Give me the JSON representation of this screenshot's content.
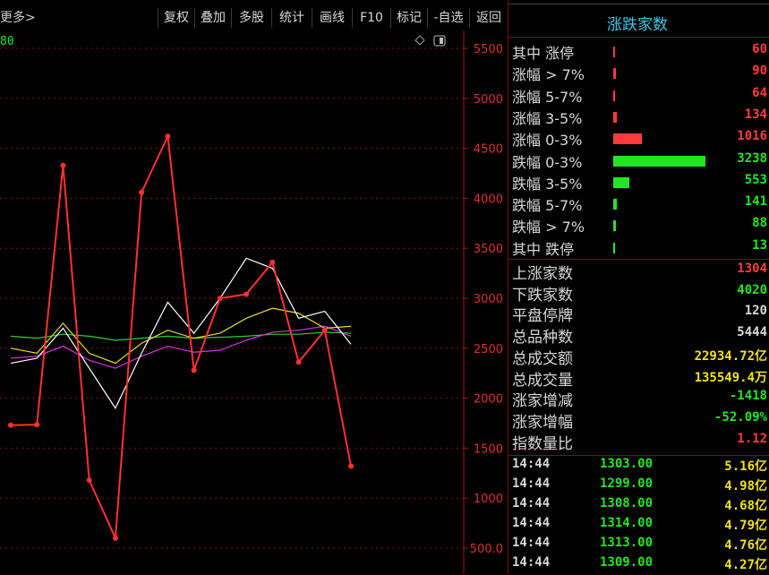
{
  "toolbar": {
    "more": "更多>",
    "buttons": [
      "复权",
      "叠加",
      "多股",
      "统计",
      "画线",
      "F10",
      "标记",
      "-自选",
      "返回"
    ]
  },
  "chart": {
    "corner_value": "80"
  },
  "chart_data": {
    "type": "line",
    "y_ticks": [
      "5500",
      "5000",
      "4500",
      "4000",
      "3500",
      "3000",
      "2500",
      "2000",
      "1500",
      "1000",
      "500.0"
    ],
    "ylim": [
      500,
      5500
    ],
    "grid": true,
    "series": [
      {
        "color": "#ff3030",
        "values": [
          1730,
          1735,
          4330,
          1180,
          600,
          4060,
          4620,
          2280,
          3000,
          3040,
          3360,
          2360,
          2680,
          1320
        ]
      },
      {
        "color": "#ffffff",
        "values": [
          2350,
          2400,
          2700,
          2300,
          1900,
          2450,
          2960,
          2650,
          3000,
          3400,
          3300,
          2800,
          2870,
          2540
        ]
      },
      {
        "color": "#e8e020",
        "values": [
          2500,
          2450,
          2750,
          2450,
          2350,
          2550,
          2680,
          2600,
          2650,
          2800,
          2900,
          2850,
          2700,
          2720
        ]
      },
      {
        "color": "#e030e0",
        "values": [
          2400,
          2420,
          2520,
          2380,
          2300,
          2420,
          2520,
          2460,
          2480,
          2580,
          2660,
          2680,
          2720,
          2620
        ]
      },
      {
        "color": "#30d030",
        "values": [
          2620,
          2600,
          2640,
          2620,
          2580,
          2600,
          2620,
          2600,
          2610,
          2620,
          2640,
          2640,
          2660,
          2650
        ]
      }
    ]
  },
  "panel": {
    "title": "涨跌家数",
    "dist": [
      {
        "label": "其中 涨停",
        "value": "60",
        "cls": "up",
        "bar": 0.02
      },
      {
        "label": "涨幅 > 7%",
        "value": "90",
        "cls": "up",
        "bar": 0.03
      },
      {
        "label": "涨幅 5-7%",
        "value": "64",
        "cls": "up",
        "bar": 0.02
      },
      {
        "label": "涨幅 3-5%",
        "value": "134",
        "cls": "up",
        "bar": 0.04
      },
      {
        "label": "涨幅 0-3%",
        "value": "1016",
        "cls": "up",
        "bar": 0.31
      },
      {
        "label": "跌幅 0-3%",
        "value": "3238",
        "cls": "dn",
        "bar": 1.0
      },
      {
        "label": "跌幅 3-5%",
        "value": "553",
        "cls": "dn",
        "bar": 0.17
      },
      {
        "label": "跌幅 5-7%",
        "value": "141",
        "cls": "dn",
        "bar": 0.04
      },
      {
        "label": "跌幅 > 7%",
        "value": "88",
        "cls": "dn",
        "bar": 0.03
      },
      {
        "label": "其中 跌停",
        "value": "13",
        "cls": "dn",
        "bar": 0.01
      }
    ],
    "stats": [
      {
        "label": "上涨家数",
        "value": "1304",
        "cls": "up"
      },
      {
        "label": "下跌家数",
        "value": "4020",
        "cls": "dn"
      },
      {
        "label": "平盘停牌",
        "value": "120",
        "cls": "wh"
      },
      {
        "label": "总品种数",
        "value": "5444",
        "cls": "wh"
      },
      {
        "label": "总成交额",
        "value": "22934.72亿",
        "cls": "yl"
      },
      {
        "label": "总成交量",
        "value": "135549.4万",
        "cls": "yl"
      },
      {
        "label": "涨家增减",
        "value": "-1418",
        "cls": "dn"
      },
      {
        "label": "涨家增幅",
        "value": "-52.09%",
        "cls": "dn"
      },
      {
        "label": "指数量比",
        "value": "1.12",
        "cls": "up"
      }
    ],
    "ticks": [
      {
        "time": "14:44",
        "price": "1303.00",
        "amount": "5.16亿"
      },
      {
        "time": "14:44",
        "price": "1299.00",
        "amount": "4.98亿"
      },
      {
        "time": "14:44",
        "price": "1308.00",
        "amount": "4.68亿"
      },
      {
        "time": "14:44",
        "price": "1314.00",
        "amount": "4.79亿"
      },
      {
        "time": "14:44",
        "price": "1313.00",
        "amount": "4.76亿"
      },
      {
        "time": "14:44",
        "price": "1309.00",
        "amount": "4.27亿"
      }
    ]
  },
  "colors": {
    "up": "#ff3b3b",
    "down": "#22e622",
    "accent": "#3ec8e8"
  }
}
